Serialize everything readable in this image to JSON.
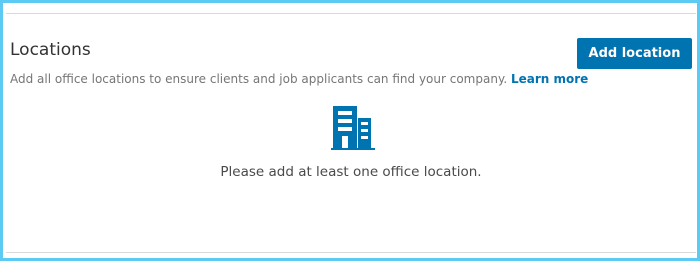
{
  "section": {
    "title": "Locations",
    "add_button_label": "Add location",
    "description": "Add all office locations to ensure clients and job applicants can find your company. ",
    "learn_more_label": "Learn more"
  },
  "empty_state": {
    "icon": "office-building-icon",
    "message": "Please add at least one office location."
  },
  "colors": {
    "accent": "#0073b1",
    "icon_fill": "#0073b1",
    "frame_border": "#5ccaf2"
  }
}
